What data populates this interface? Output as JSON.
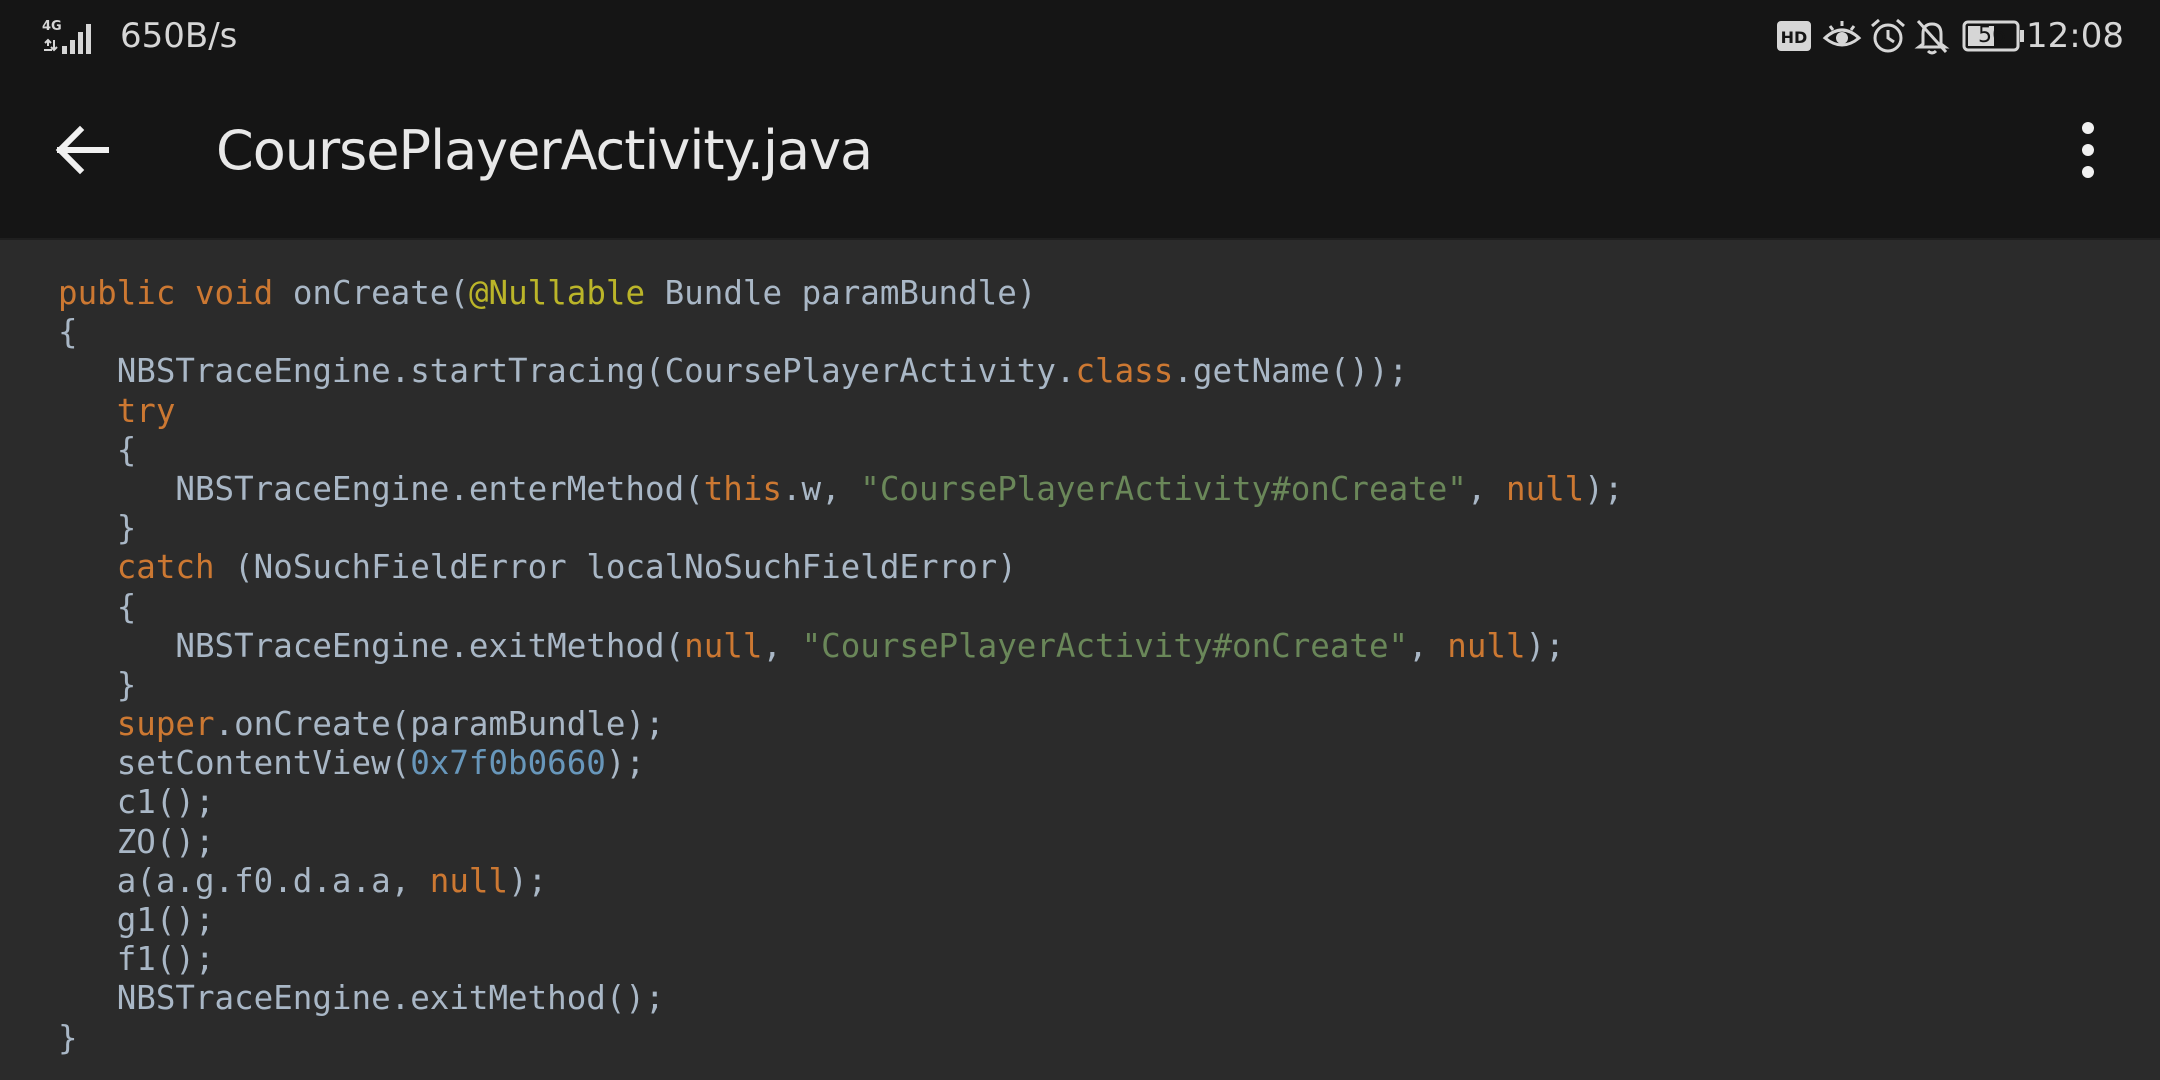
{
  "status_bar": {
    "net_speed": "650B/s",
    "network_type": "4G",
    "battery_level": "56",
    "time": "12:08",
    "icons": [
      "signal-icon",
      "hd-icon",
      "eye-icon",
      "alarm-icon",
      "bell-off-icon",
      "battery-icon"
    ]
  },
  "app_bar": {
    "title": "CoursePlayerActivity.java",
    "back_icon": "arrow-left-icon",
    "menu_icon": "more-vert-icon"
  },
  "colors": {
    "keyword": "#cc7832",
    "annotation": "#bbb529",
    "string": "#6a8759",
    "number": "#6897bb",
    "plain": "#a9b7c6",
    "background": "#2b2b2b",
    "toolbar": "#151515"
  },
  "code": {
    "lines": [
      [
        {
          "t": "kw",
          "v": "public"
        },
        {
          "t": "p",
          "v": " "
        },
        {
          "t": "kw",
          "v": "void"
        },
        {
          "t": "p",
          "v": " onCreate("
        },
        {
          "t": "ann",
          "v": "@Nullable"
        },
        {
          "t": "p",
          "v": " Bundle paramBundle)"
        }
      ],
      [
        {
          "t": "p",
          "v": "{"
        }
      ],
      [
        {
          "t": "p",
          "v": "   NBSTraceEngine.startTracing(CoursePlayerActivity."
        },
        {
          "t": "kw",
          "v": "class"
        },
        {
          "t": "p",
          "v": ".getName());"
        }
      ],
      [
        {
          "t": "p",
          "v": "   "
        },
        {
          "t": "kw",
          "v": "try"
        }
      ],
      [
        {
          "t": "p",
          "v": "   {"
        }
      ],
      [
        {
          "t": "p",
          "v": "      NBSTraceEngine.enterMethod("
        },
        {
          "t": "kw",
          "v": "this"
        },
        {
          "t": "p",
          "v": ".w, "
        },
        {
          "t": "str",
          "v": "\"CoursePlayerActivity#onCreate\""
        },
        {
          "t": "p",
          "v": ", "
        },
        {
          "t": "kw",
          "v": "null"
        },
        {
          "t": "p",
          "v": ");"
        }
      ],
      [
        {
          "t": "p",
          "v": "   }"
        }
      ],
      [
        {
          "t": "p",
          "v": "   "
        },
        {
          "t": "kw",
          "v": "catch"
        },
        {
          "t": "p",
          "v": " (NoSuchFieldError localNoSuchFieldError)"
        }
      ],
      [
        {
          "t": "p",
          "v": "   {"
        }
      ],
      [
        {
          "t": "p",
          "v": "      NBSTraceEngine.exitMethod("
        },
        {
          "t": "kw",
          "v": "null"
        },
        {
          "t": "p",
          "v": ", "
        },
        {
          "t": "str",
          "v": "\"CoursePlayerActivity#onCreate\""
        },
        {
          "t": "p",
          "v": ", "
        },
        {
          "t": "kw",
          "v": "null"
        },
        {
          "t": "p",
          "v": ");"
        }
      ],
      [
        {
          "t": "p",
          "v": "   }"
        }
      ],
      [
        {
          "t": "p",
          "v": "   "
        },
        {
          "t": "kw",
          "v": "super"
        },
        {
          "t": "p",
          "v": ".onCreate(paramBundle);"
        }
      ],
      [
        {
          "t": "p",
          "v": "   setContentView("
        },
        {
          "t": "num",
          "v": "0x7f0b0660"
        },
        {
          "t": "p",
          "v": ");"
        }
      ],
      [
        {
          "t": "p",
          "v": "   c1();"
        }
      ],
      [
        {
          "t": "p",
          "v": "   ZO();"
        }
      ],
      [
        {
          "t": "p",
          "v": "   a(a.g.f0.d.a.a, "
        },
        {
          "t": "kw",
          "v": "null"
        },
        {
          "t": "p",
          "v": ");"
        }
      ],
      [
        {
          "t": "p",
          "v": "   g1();"
        }
      ],
      [
        {
          "t": "p",
          "v": "   f1();"
        }
      ],
      [
        {
          "t": "p",
          "v": "   NBSTraceEngine.exitMethod();"
        }
      ],
      [
        {
          "t": "p",
          "v": "}"
        }
      ]
    ]
  }
}
